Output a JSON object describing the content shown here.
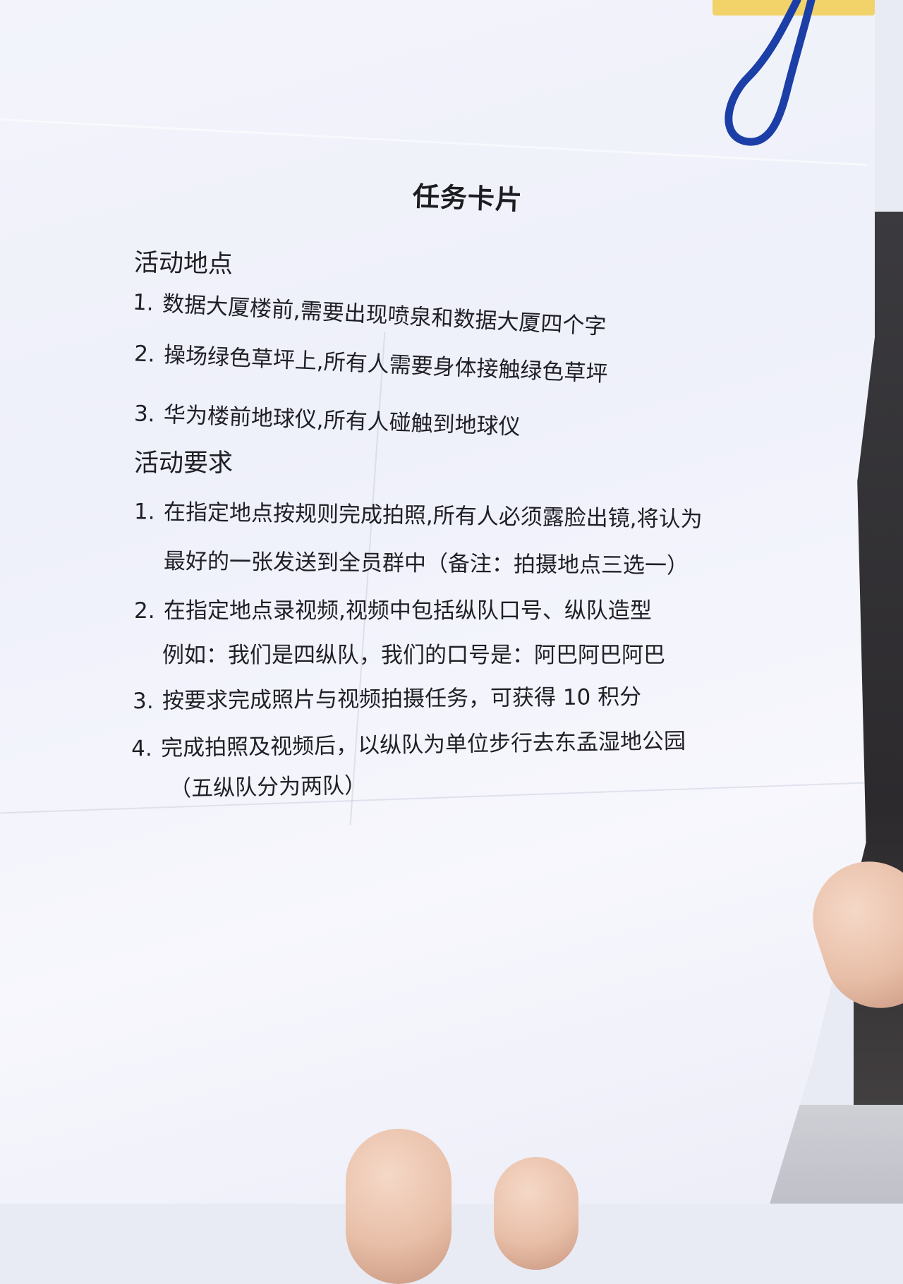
{
  "title": "任务卡片",
  "sections": [
    {
      "heading": "活动地点",
      "items": [
        {
          "num": "1.",
          "text": "数据大厦楼前,需要出现喷泉和数据大厦四个字"
        },
        {
          "num": "2.",
          "text": "操场绿色草坪上,所有人需要身体接触绿色草坪"
        },
        {
          "num": "3.",
          "text": "华为楼前地球仪,所有人碰触到地球仪"
        }
      ]
    },
    {
      "heading": "活动要求",
      "items": [
        {
          "num": "1.",
          "text": "在指定地点按规则完成拍照,所有人必须露脸出镜,将认为",
          "cont": "最好的一张发送到全员群中（备注：拍摄地点三选一）"
        },
        {
          "num": "2.",
          "text": "在指定地点录视频,视频中包括纵队口号、纵队造型",
          "cont": "例如：我们是四纵队，我们的口号是：阿巴阿巴阿巴"
        },
        {
          "num": "3.",
          "text": "按要求完成照片与视频拍摄任务，可获得 10 积分"
        },
        {
          "num": "4.",
          "text": "完成拍照及视频后，以纵队为单位步行去东孟湿地公园",
          "cont": "（五纵队分为两队）"
        }
      ]
    }
  ],
  "colors": {
    "paper": "#f1f2fa",
    "text": "#1f1f25",
    "cord": "#1b3fa6",
    "tab": "#f1d36a"
  }
}
